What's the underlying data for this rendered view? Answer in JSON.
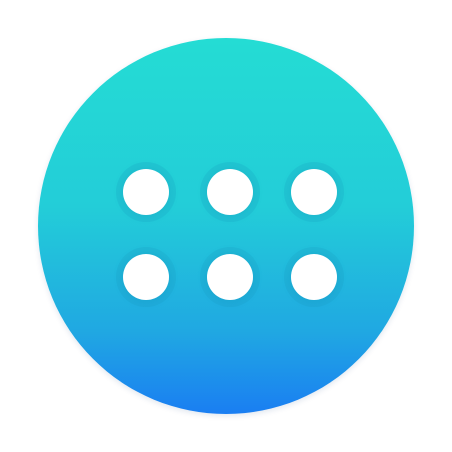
{
  "icon": {
    "name": "app-grid-icon",
    "colors": {
      "gradient_top": "#24dcd4",
      "gradient_mid": "#23cdd8",
      "gradient_bottom": "#1a7ef2",
      "dot_fill": "#ffffff",
      "background": "#ffffff"
    },
    "dots": [
      {
        "name": "grid-dot-1-1"
      },
      {
        "name": "grid-dot-1-2"
      },
      {
        "name": "grid-dot-1-3"
      },
      {
        "name": "grid-dot-2-1"
      },
      {
        "name": "grid-dot-2-2"
      },
      {
        "name": "grid-dot-2-3"
      }
    ]
  }
}
